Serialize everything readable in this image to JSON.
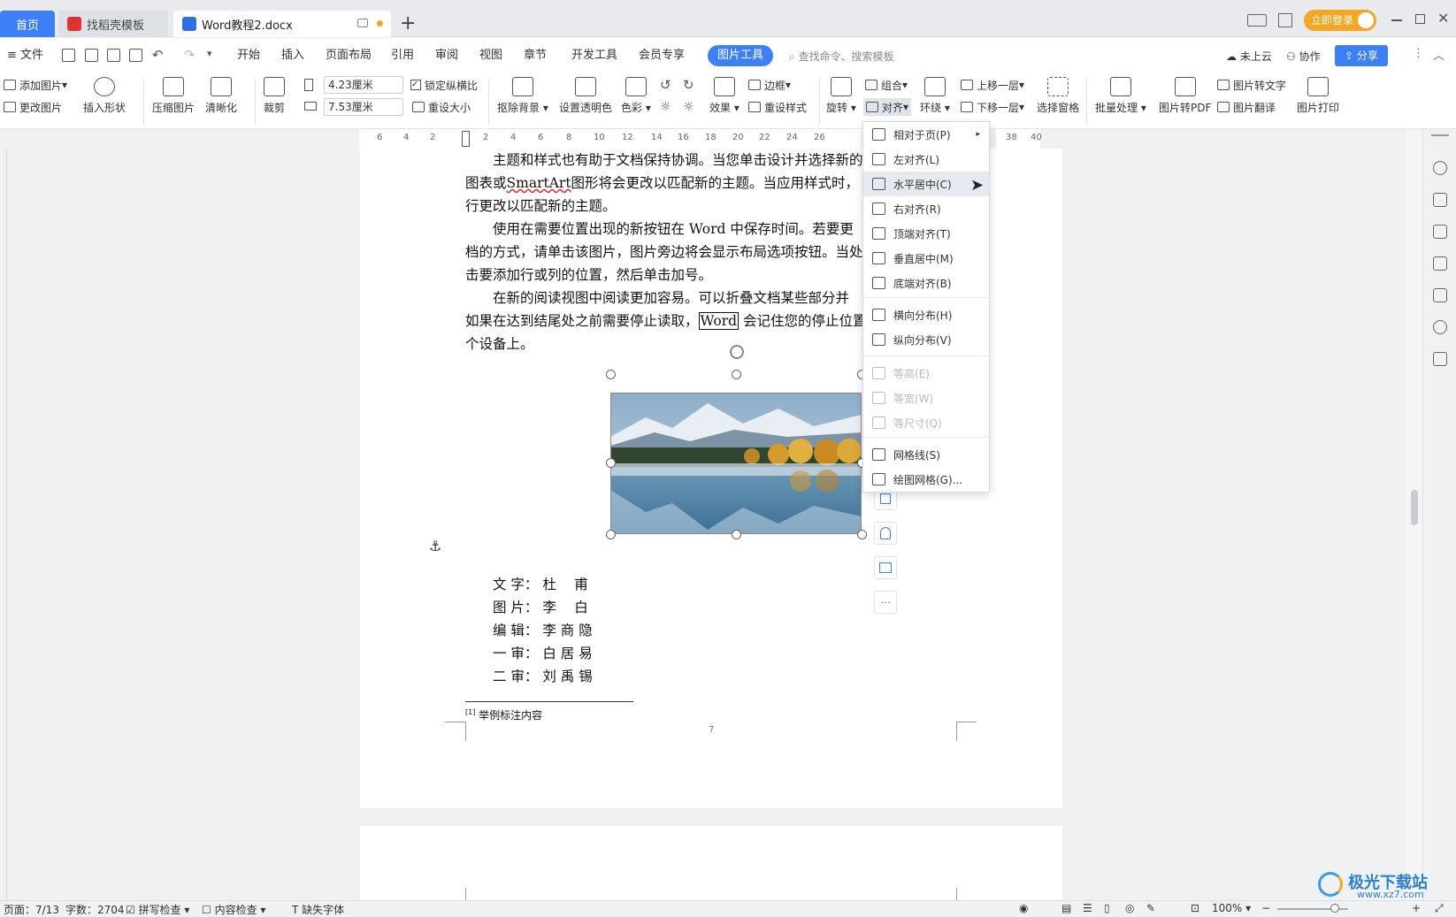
{
  "tabs": {
    "home": "首页",
    "template": "找稻壳模板",
    "doc": "Word教程2.docx",
    "add": "+"
  },
  "title_right": {
    "login": "立即登录"
  },
  "menu": {
    "file": "文件",
    "items": [
      "开始",
      "插入",
      "页面布局",
      "引用",
      "审阅",
      "视图",
      "章节",
      "开发工具",
      "会员专享"
    ],
    "active": "图片工具",
    "search": "查找命令、搜索模板",
    "cloud": "未上云",
    "collab": "协作",
    "share": "分享"
  },
  "ribbon": {
    "add_image": "添加图片",
    "change_image": "更改图片",
    "insert_shape": "插入形状",
    "compress": "压缩图片",
    "sharpen": "清晰化",
    "crop": "裁剪",
    "height": "4.23厘米",
    "width": "7.53厘米",
    "lock_ratio": "锁定纵横比",
    "reset_size": "重设大小",
    "remove_bg": "抠除背景",
    "transparent": "设置透明色",
    "color": "色彩",
    "effects": "效果",
    "border": "边框",
    "reset_style": "重设样式",
    "rotate": "旋转",
    "group": "组合",
    "align": "对齐",
    "wrap": "环绕",
    "bring_forward": "上移一层",
    "send_backward": "下移一层",
    "selection_pane": "选择窗格",
    "batch": "批量处理",
    "to_pdf": "图片转PDF",
    "to_text": "图片转文字",
    "translate": "图片翻译",
    "print": "图片打印"
  },
  "dropdown": {
    "items": [
      {
        "label": "相对于页(P)",
        "state": "normal",
        "submenu": true
      },
      {
        "label": "左对齐(L)",
        "state": "normal"
      },
      {
        "label": "水平居中(C)",
        "state": "highlight"
      },
      {
        "label": "右对齐(R)",
        "state": "normal"
      },
      {
        "label": "顶端对齐(T)",
        "state": "normal"
      },
      {
        "label": "垂直居中(M)",
        "state": "normal"
      },
      {
        "label": "底端对齐(B)",
        "state": "normal"
      },
      {
        "label": "横向分布(H)",
        "state": "normal"
      },
      {
        "label": "纵向分布(V)",
        "state": "normal"
      },
      {
        "label": "等高(E)",
        "state": "disabled"
      },
      {
        "label": "等宽(W)",
        "state": "disabled"
      },
      {
        "label": "等尺寸(Q)",
        "state": "disabled"
      },
      {
        "label": "网格线(S)",
        "state": "normal"
      },
      {
        "label": "绘图网格(G)...",
        "state": "normal"
      }
    ]
  },
  "document": {
    "para1_l1": "主题和样式也有助于文档保持协调。当您单击设计并选择新的",
    "para1_l2a": "图表或",
    "para1_l2b": "SmartArt",
    "para1_l2c": "图形将会更改以匹配新的主题。当应用样式时，",
    "para1_l3": "行更改以匹配新的主题。",
    "para2_l1": "使用在需要位置出现的新按钮在 Word 中保存时间。若要更",
    "para2_l2": "档的方式，请单击该图片，图片旁边将会显示布局选项按钮。当处",
    "para2_l3": "击要添加行或列的位置，然后单击加号。",
    "para3_l1": "在新的阅读视图中阅读更加容易。可以折叠文档某些部分并",
    "para3_l2a": "如果在达到结尾处之前需要停止读取，",
    "para3_l2b": "Word",
    "para3_l2c": "会记住您的停止位置",
    "para3_l3": "个设备上。",
    "credits": [
      "文 字： 杜　 甫",
      "图 片： 李　 白",
      "编 辑： 李 商 隐",
      "一 审： 白 居 易",
      "二 审： 刘 禹 锡"
    ],
    "footnote_mark": "[1]",
    "footnote": "举例标注内容",
    "page_number": "7"
  },
  "ruler": {
    "labels": [
      "6",
      "4",
      "2",
      "2",
      "4",
      "6",
      "8",
      "10",
      "12",
      "14",
      "16",
      "18",
      "20",
      "22",
      "24",
      "26",
      "38",
      "40"
    ]
  },
  "status": {
    "page": "页面：7/13",
    "words": "字数：2704",
    "spell": "拼写检查",
    "content": "内容检查",
    "font_missing": "缺失字体",
    "zoom": "100%"
  },
  "watermark": {
    "brand": "极光下载站",
    "url": "www.xz7.com"
  },
  "colors": {
    "accent": "#3d7ff5",
    "login": "#f5a623"
  }
}
